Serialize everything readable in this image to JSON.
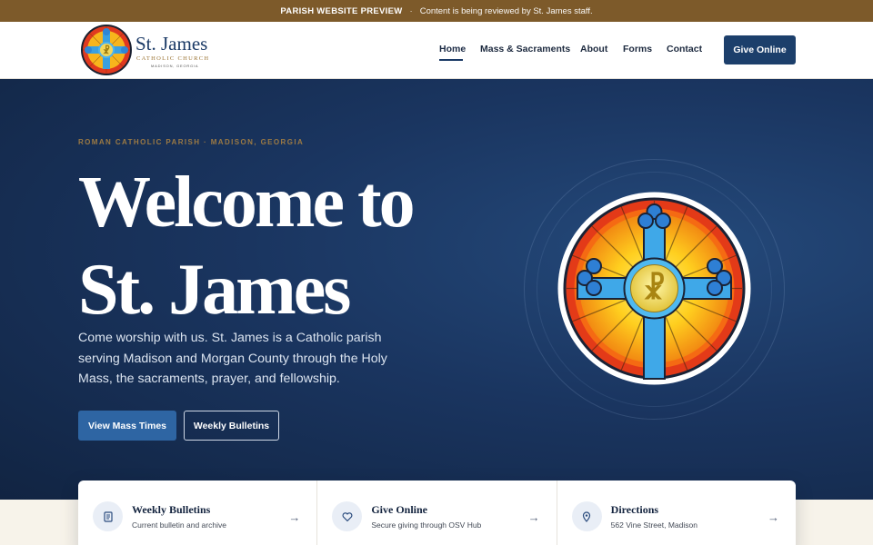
{
  "announcement": {
    "label": "PARISH WEBSITE PREVIEW",
    "separator": "·",
    "message": "Content is being reviewed by St. James staff."
  },
  "brand": {
    "name": "St. James",
    "subtitle": "CATHOLIC CHURCH",
    "location": "MADISON, GEORGIA",
    "logo_icon": "stained-glass-chi-rho-icon"
  },
  "nav": {
    "items": [
      {
        "label": "Home",
        "active": true
      },
      {
        "label": "Mass & Sacraments",
        "active": false
      },
      {
        "label": "About",
        "active": false
      },
      {
        "label": "Forms",
        "active": false
      },
      {
        "label": "Contact",
        "active": false
      }
    ],
    "cta_label": "Give Online"
  },
  "hero": {
    "eyebrow": "ROMAN CATHOLIC PARISH · MADISON, GEORGIA",
    "title_line1": "Welcome to",
    "title_line2": "St. James",
    "intro": "Come worship with us. St. James is a Catholic parish serving Madison and Morgan County through the Holy Mass, the sacraments, prayer, and fellowship.",
    "primary_button": "View Mass Times",
    "secondary_button": "Weekly Bulletins",
    "image_icon": "stained-glass-window-icon"
  },
  "quick_links": [
    {
      "title": "Weekly Bulletins",
      "subtitle": "Current bulletin and archive",
      "icon": "document-icon",
      "arrow": "→"
    },
    {
      "title": "Give Online",
      "subtitle": "Secure giving through OSV Hub",
      "icon": "heart-icon",
      "arrow": "→"
    },
    {
      "title": "Directions",
      "subtitle": "562 Vine Street, Madison",
      "icon": "map-pin-icon",
      "arrow": "→"
    }
  ],
  "colors": {
    "announcement_bg": "#7d5a2a",
    "brand_navy": "#1c3f6b",
    "hero_bg": "#1a3560",
    "primary_button": "#2e65a3",
    "accent_gold": "#9c7a44"
  }
}
